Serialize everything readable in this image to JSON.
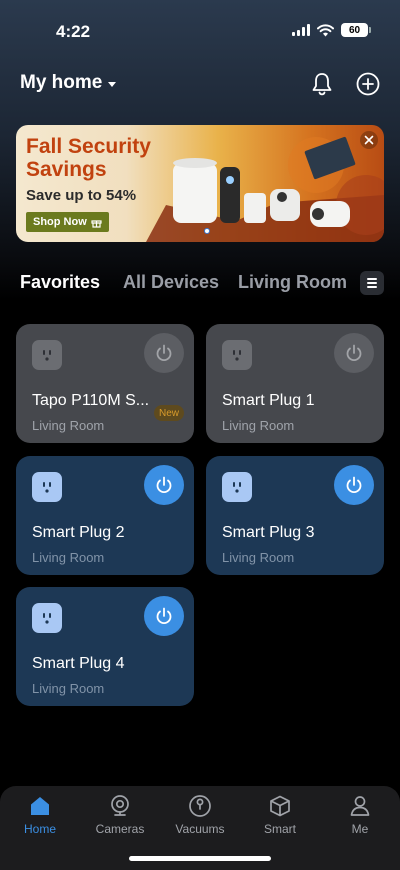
{
  "status": {
    "time": "4:22",
    "battery": "60"
  },
  "header": {
    "home_title": "My home"
  },
  "banner": {
    "title_line1": "Fall Security",
    "title_line2": "Savings",
    "subtitle": "Save up to 54%",
    "cta": "Shop Now"
  },
  "tabs": [
    {
      "label": "Favorites"
    },
    {
      "label": "All Devices"
    },
    {
      "label": "Living Room"
    }
  ],
  "devices": [
    {
      "name": "Tapo P110M S...",
      "room": "Living Room",
      "badge": "New",
      "state": "off"
    },
    {
      "name": "Smart Plug 1",
      "room": "Living Room",
      "state": "off"
    },
    {
      "name": "Smart Plug 2",
      "room": "Living Room",
      "state": "on"
    },
    {
      "name": "Smart Plug 3",
      "room": "Living Room",
      "state": "on"
    },
    {
      "name": "Smart Plug 4",
      "room": "Living Room",
      "state": "on"
    }
  ],
  "tabbar": [
    {
      "label": "Home",
      "icon": "home-icon"
    },
    {
      "label": "Cameras",
      "icon": "camera-icon"
    },
    {
      "label": "Vacuums",
      "icon": "vacuum-icon"
    },
    {
      "label": "Smart",
      "icon": "cube-icon"
    },
    {
      "label": "Me",
      "icon": "person-icon"
    }
  ],
  "colors": {
    "accent": "#3b8fe3",
    "card_off": "#46484d",
    "card_on": "#1d3855"
  }
}
